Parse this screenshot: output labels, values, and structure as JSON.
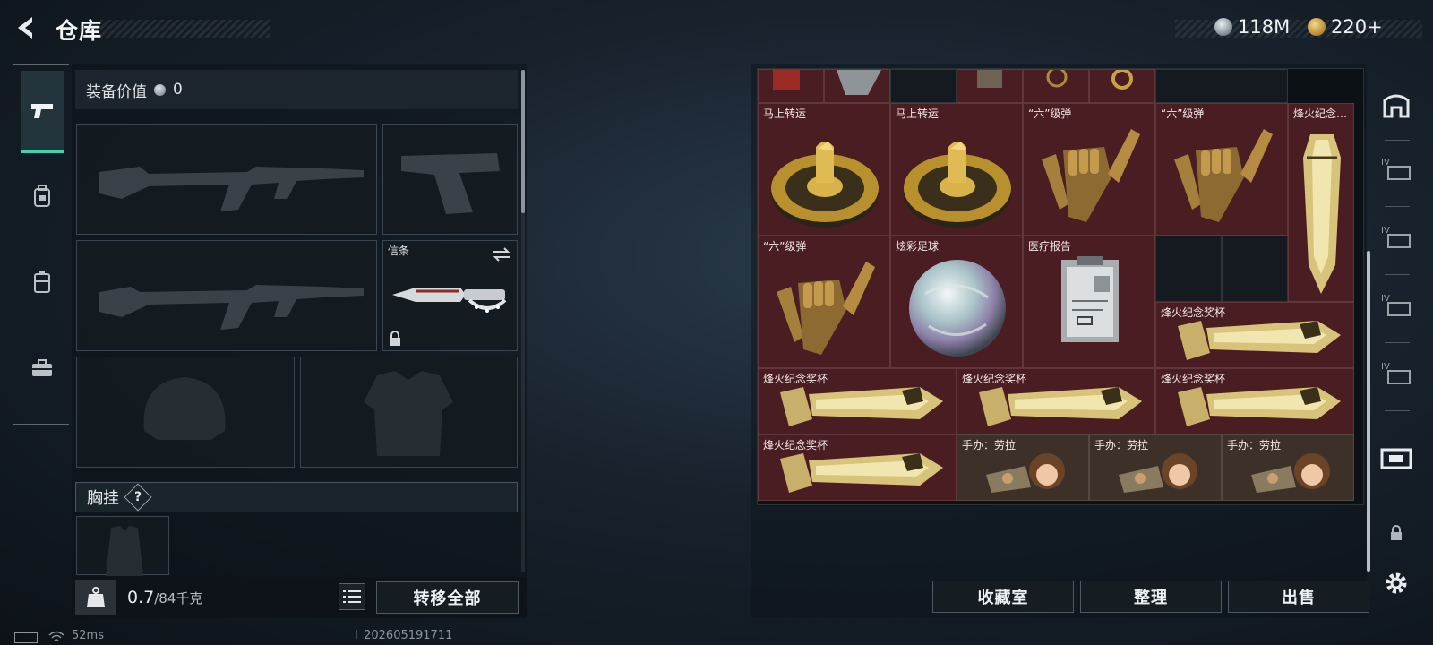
{
  "header": {
    "title": "仓库",
    "currencies": [
      {
        "icon": "silver-coin-icon",
        "amount": "118M"
      },
      {
        "icon": "gold-coin-icon",
        "amount": "220+"
      }
    ]
  },
  "left_tabs": [
    {
      "icon": "pistol-icon",
      "active": true
    },
    {
      "icon": "backpack-icon",
      "active": false
    },
    {
      "icon": "case-icon",
      "active": false
    },
    {
      "icon": "toolbox-icon",
      "active": false
    }
  ],
  "loadout": {
    "value_label": "装备价值",
    "value_amount": "0",
    "knife_slot_label": "信条",
    "rig_label": "胸挂",
    "rig_help": "?",
    "weight_current": "0.7",
    "weight_max": "/84千克",
    "weight_icon_text": "KG",
    "transfer_all": "转移全部"
  },
  "grid_items": [
    {
      "name": "马上转运",
      "kind": "horse-disc"
    },
    {
      "name": "马上转运",
      "kind": "horse-disc"
    },
    {
      "name": "“六”级弹",
      "kind": "hand"
    },
    {
      "name": "“六”级弹",
      "kind": "hand"
    },
    {
      "name": "烽火纪念…",
      "kind": "trophy-vertical"
    },
    {
      "name": "“六”级弹",
      "kind": "hand"
    },
    {
      "name": "炫彩足球",
      "kind": "ball"
    },
    {
      "name": "医疗报告",
      "kind": "report"
    },
    {
      "name": "烽火纪念奖杯",
      "kind": "trophy"
    },
    {
      "name": "烽火纪念奖杯",
      "kind": "trophy"
    },
    {
      "name": "烽火纪念奖杯",
      "kind": "trophy"
    },
    {
      "name": "烽火纪念奖杯",
      "kind": "trophy"
    },
    {
      "name": "烽火纪念奖杯",
      "kind": "trophy"
    },
    {
      "name": "手办：劳拉",
      "kind": "figure"
    },
    {
      "name": "手办：劳拉",
      "kind": "figure"
    },
    {
      "name": "手办：劳拉",
      "kind": "figure"
    }
  ],
  "actions": {
    "collection": "收藏室",
    "sort": "整理",
    "sell": "出售"
  },
  "right_rail": [
    {
      "icon": "storage-icon"
    },
    {
      "icon": "case-iv-icon"
    },
    {
      "icon": "case-iv-icon"
    },
    {
      "icon": "case-iv-icon"
    },
    {
      "icon": "case-iv-icon"
    },
    {
      "icon": "collection-case-icon"
    },
    {
      "icon": "lock-icon"
    },
    {
      "icon": "settings-gear-icon"
    }
  ],
  "status": {
    "ping": "52ms",
    "build": "l_202605191711"
  },
  "colors": {
    "accent": "#3ed5b0",
    "cell_red": "#4a1d22",
    "cell_brown": "#3d3028"
  }
}
